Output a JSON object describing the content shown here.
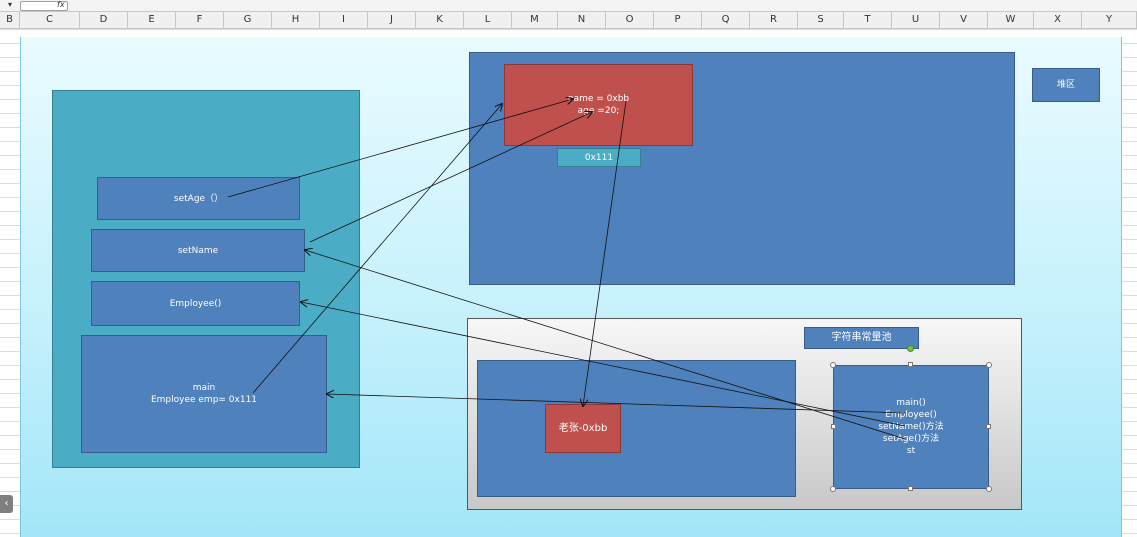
{
  "formula_bar": {
    "dropdown_glyph": "▾",
    "fx_label": "fx"
  },
  "columns": [
    "B",
    "C",
    "D",
    "E",
    "F",
    "G",
    "H",
    "I",
    "J",
    "K",
    "L",
    "M",
    "N",
    "O",
    "P",
    "Q",
    "R",
    "S",
    "T",
    "U",
    "V",
    "W",
    "X",
    "Y"
  ],
  "diagram": {
    "heap_label": "堆区",
    "object_field_name": "name = 0xbb",
    "object_field_age": "age =20;",
    "object_address": "0x111",
    "string_pool_label": "字符串常量池",
    "string_pool_entry": "老张-0xbb",
    "stack_frames": {
      "set_age": "setAge（）",
      "set_name": "setName",
      "employee_ctor": "Employee()",
      "main_title": "main",
      "main_var": "Employee emp= 0x111"
    },
    "method_area_list": [
      "main()",
      "Employee()",
      "setName()方法",
      "setAge()方法",
      "st"
    ]
  },
  "colors": {
    "shape_blue": "#4f81bd",
    "shape_teal": "#4bacc6",
    "shape_red": "#c0504d",
    "canvas_light": "#e9fbff",
    "canvas_dark": "#a3e6f8"
  },
  "collapse_tab_glyph": "‹"
}
